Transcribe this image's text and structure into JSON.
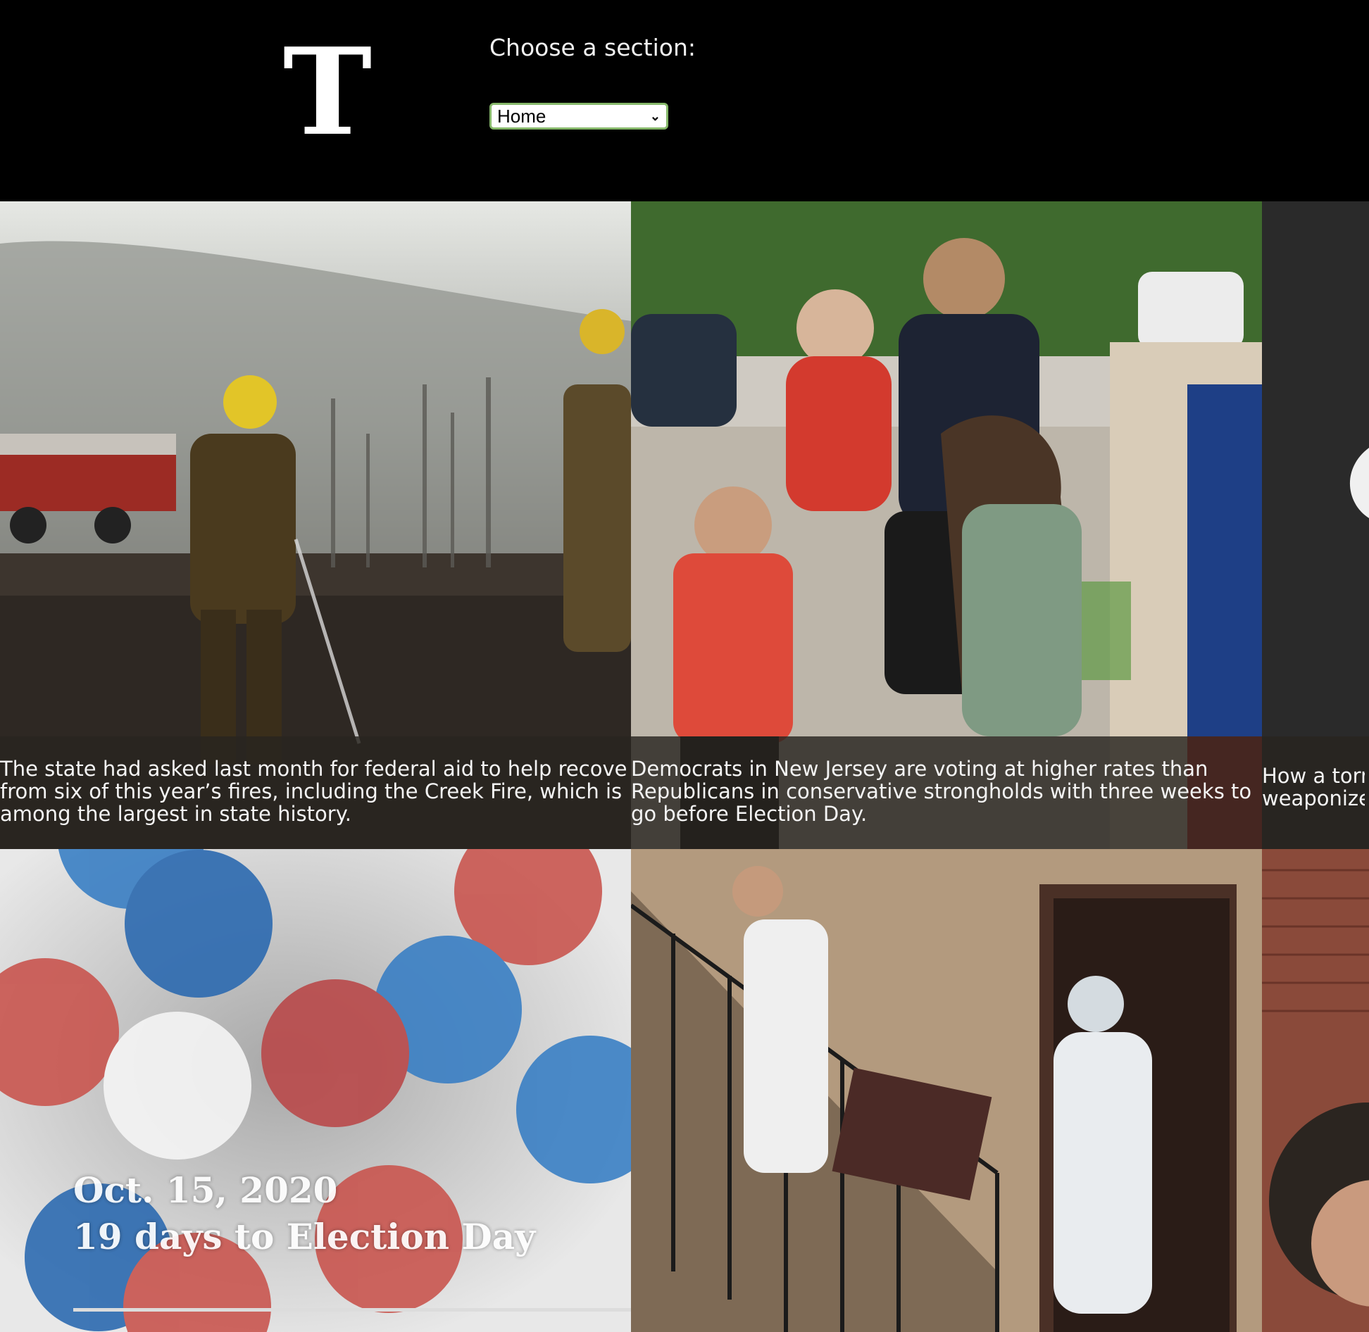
{
  "header": {
    "logo_letter": "T",
    "section_label": "Choose a section:",
    "section_select": {
      "selected": "Home"
    }
  },
  "articles": [
    {
      "caption_lines": [
        "The state had asked last month for federal aid to help recover",
        "from six of this year’s fires, including the Creek Fire, which is",
        "among the largest in state history."
      ]
    },
    {
      "caption_lines": [
        "Democrats in New Jersey are voting at higher rates than",
        "Republicans in conservative strongholds with three weeks to",
        "go before Election Day."
      ]
    },
    {
      "caption_lines": [
        "How a torn",
        "weaponize"
      ]
    },
    {
      "image_text": {
        "date": "Oct. 15, 2020",
        "countdown": "19 days to Election Day"
      }
    }
  ],
  "colors": {
    "background": "#000000",
    "caption_overlay": "#28241f",
    "select_border": "#86b86a",
    "dot_red": "#c9554f",
    "dot_blue": "#3a7fc4"
  }
}
